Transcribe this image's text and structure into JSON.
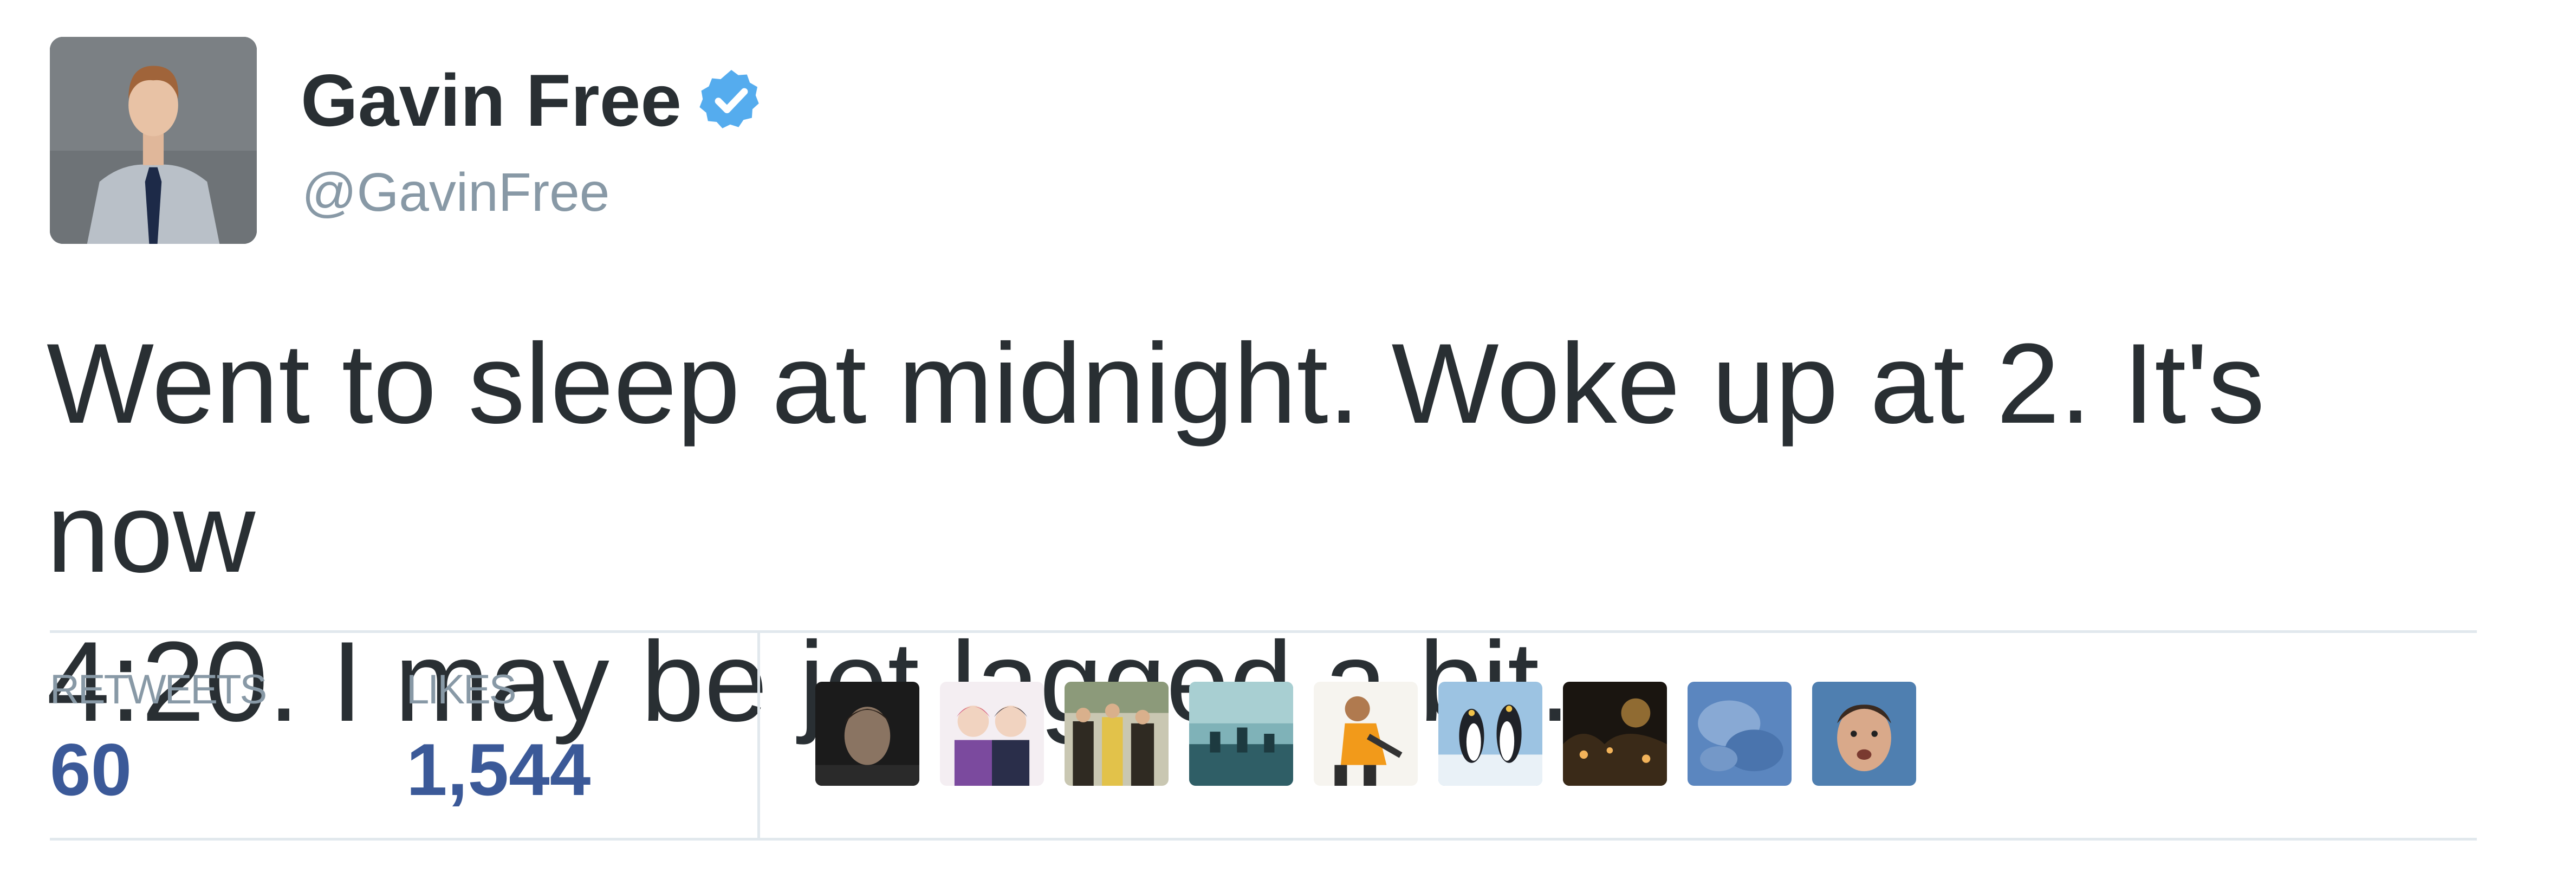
{
  "author": {
    "display_name": "Gavin Free",
    "handle": "@GavinFree",
    "verified": true,
    "avatar_icon": "profile-photo-icon"
  },
  "tweet": {
    "text": "Went to sleep at midnight. Woke up at 2. It's now\n4:20. I may be jet lagged a bit."
  },
  "stats": {
    "retweets_label": "RETWEETS",
    "retweets_value": "60",
    "likes_label": "LIKES",
    "likes_value": "1,544"
  },
  "colors": {
    "text": "#292f33",
    "muted": "#8899a6",
    "stat_value": "#3b5998",
    "verified_badge": "#55acee",
    "divider": "#e1e8ed"
  },
  "likers": [
    {
      "icon": "liker-avatar-1-icon"
    },
    {
      "icon": "liker-avatar-2-icon"
    },
    {
      "icon": "liker-avatar-3-icon"
    },
    {
      "icon": "liker-avatar-4-icon"
    },
    {
      "icon": "liker-avatar-5-icon"
    },
    {
      "icon": "liker-avatar-6-icon"
    },
    {
      "icon": "liker-avatar-7-icon"
    },
    {
      "icon": "liker-avatar-8-icon"
    },
    {
      "icon": "liker-avatar-9-icon"
    }
  ]
}
